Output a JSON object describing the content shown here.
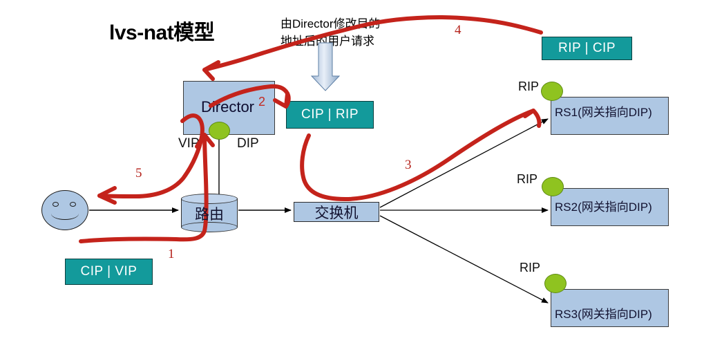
{
  "title": "lvs-nat模型",
  "note": {
    "line1": "由Director修改目的",
    "line2": "地址后的用户请求"
  },
  "director": {
    "label": "Director",
    "step_marker": "2",
    "vip_label": "VIP",
    "dip_label": "DIP"
  },
  "packets": {
    "cip_rip": "CIP | RIP",
    "rip_cip": "RIP | CIP",
    "cip_vip": "CIP | VIP"
  },
  "network": {
    "router": "路由",
    "switch": "交换机"
  },
  "real_servers": [
    {
      "name": "RS1(网关指向DIP)",
      "nic_label": "RIP"
    },
    {
      "name": "RS2(网关指向DIP)",
      "nic_label": "RIP"
    },
    {
      "name": "RS3(网关指向DIP)",
      "nic_label": "RIP"
    }
  ],
  "steps": {
    "s1": "1",
    "s3": "3",
    "s4": "4",
    "s5": "5"
  },
  "colors": {
    "node_fill": "#aec7e3",
    "packet_fill": "#139a9b",
    "nic_green": "#8fc320",
    "annotation_red": "#c4231b",
    "arrow_blue_light": "#dce6f2",
    "arrow_blue_dark": "#8ca9c9"
  }
}
